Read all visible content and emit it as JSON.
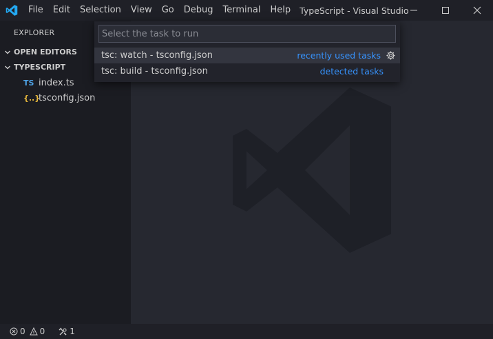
{
  "titlebar": {
    "menu": [
      "File",
      "Edit",
      "Selection",
      "View",
      "Go",
      "Debug",
      "Terminal",
      "Help"
    ],
    "window_title": "TypeScript - Visual Studio C...",
    "brand_color": "#23a9f2"
  },
  "sidebar": {
    "title": "EXPLORER",
    "sections": [
      {
        "label": "OPEN EDITORS",
        "expanded": true
      },
      {
        "label": "TYPESCRIPT",
        "expanded": true
      }
    ],
    "files": [
      {
        "icon_text": "TS",
        "icon": "typescript-file-icon",
        "name": "index.ts"
      },
      {
        "icon_text": "{..}",
        "icon": "json-file-icon",
        "name": "tsconfig.json"
      }
    ]
  },
  "quickpick": {
    "placeholder": "Select the task to run",
    "items": [
      {
        "label": "tsc: watch - tsconfig.json",
        "group": "recently used tasks",
        "active": true,
        "icon": "gear-icon"
      },
      {
        "label": "tsc: build - tsconfig.json",
        "group": "detected tasks",
        "active": false
      }
    ]
  },
  "statusbar": {
    "errors": "0",
    "warnings": "0",
    "tools": "1"
  }
}
